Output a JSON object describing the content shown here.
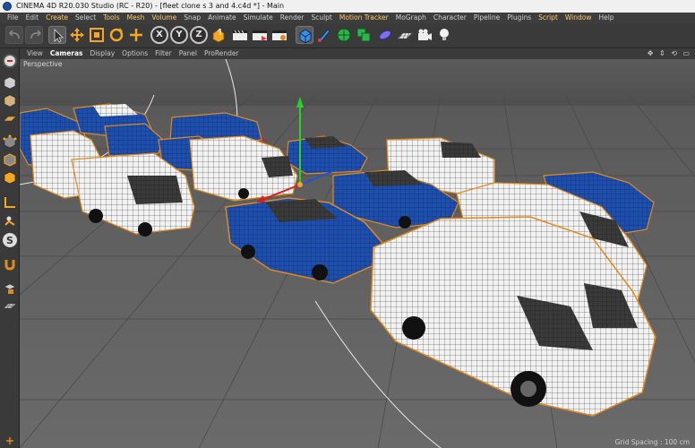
{
  "window": {
    "title": "CINEMA 4D R20.030 Studio (RC - R20) - [fleet clone s 3 and 4.c4d *] - Main"
  },
  "menubar": {
    "items": [
      "File",
      "Edit",
      "Create",
      "Select",
      "Tools",
      "Mesh",
      "Volume",
      "Snap",
      "Animate",
      "Simulate",
      "Render",
      "Sculpt",
      "Motion Tracker",
      "MoGraph",
      "Character",
      "Pipeline",
      "Plugins",
      "Script",
      "Window",
      "Help"
    ],
    "highlighted": [
      "Create",
      "Tools",
      "Mesh",
      "Volume",
      "Motion Tracker",
      "Script",
      "Window"
    ]
  },
  "toolbar": {
    "axis_labels": [
      "X",
      "Y",
      "Z"
    ],
    "tools": [
      "undo-icon",
      "redo-icon",
      "live-selection-icon",
      "move-icon",
      "scale-icon",
      "rotate-icon",
      "recent-tool-icon",
      "x-axis-lock-icon",
      "y-axis-lock-icon",
      "z-axis-lock-icon",
      "coordinate-system-icon",
      "render-active-view-icon",
      "render-to-picture-viewer-icon",
      "edit-render-settings-icon",
      "cube-primitive-icon",
      "pen-spline-icon",
      "subdivision-icon",
      "array-generator-icon",
      "deformer-icon",
      "floor-icon",
      "camera-icon",
      "light-icon"
    ]
  },
  "left_palette": {
    "tools": [
      "make-editable-icon",
      "model-mode-icon",
      "texture-mode-icon",
      "workplane-icon",
      "points-mode-icon",
      "edges-mode-icon",
      "polygons-mode-icon",
      "axis-mode-icon",
      "tweak-mode-icon",
      "solo-icon",
      "snap-icon",
      "lock-workplane-icon",
      "workplane-grid-icon",
      "planar-workplane-icon"
    ]
  },
  "viewport": {
    "menu": [
      "View",
      "Cameras",
      "Display",
      "Options",
      "Filter",
      "Panel",
      "ProRender"
    ],
    "active_menu": "Cameras",
    "view_name": "Perspective",
    "grid_spacing": "Grid Spacing : 100 cm"
  },
  "colors": {
    "car_blue": "#1e4fae",
    "van_white": "#f2f2f2",
    "wire": "#1a1a1a",
    "selection_outline": "#e08a1c",
    "axis_x": "#d42020",
    "axis_y": "#2ad12a",
    "axis_z": "#2050e0"
  }
}
